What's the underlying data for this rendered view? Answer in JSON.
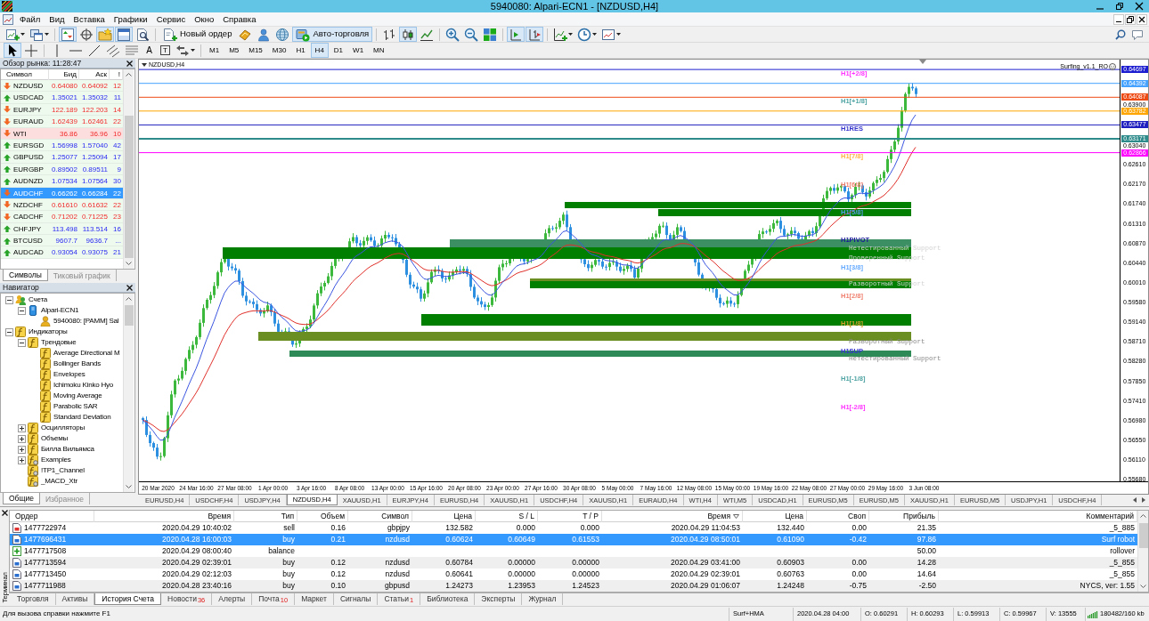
{
  "window": {
    "title": "5940080: Alpari-ECN1 - [NZDUSD,H4]"
  },
  "menu": [
    "Файл",
    "Вид",
    "Вставка",
    "Графики",
    "Сервис",
    "Окно",
    "Справка"
  ],
  "toolbar_1": [
    {
      "kind": "new-chart",
      "dropdown": true,
      "pressed": false
    },
    {
      "kind": "profiles",
      "dropdown": true,
      "pressed": false
    },
    {
      "kind": "separator"
    },
    {
      "kind": "market-watch",
      "pressed": true
    },
    {
      "kind": "data-window",
      "pressed": false
    },
    {
      "kind": "navigator",
      "pressed": true
    },
    {
      "kind": "terminal",
      "pressed": true
    },
    {
      "kind": "tester",
      "pressed": false
    },
    {
      "kind": "separator"
    },
    {
      "kind": "new-order",
      "label": "Новый ордер",
      "pressed": false
    },
    {
      "kind": "metaeditor",
      "pressed": false
    },
    {
      "kind": "account",
      "pressed": false
    },
    {
      "kind": "signals",
      "pressed": false
    },
    {
      "kind": "auto-trading",
      "label": "Авто-торговля",
      "pressed": true
    },
    {
      "kind": "separator"
    },
    {
      "kind": "bar-chart",
      "pressed": false
    },
    {
      "kind": "candles",
      "pressed": true
    },
    {
      "kind": "line-chart",
      "pressed": false
    },
    {
      "kind": "separator"
    },
    {
      "kind": "zoom-in",
      "pressed": false
    },
    {
      "kind": "zoom-out",
      "pressed": false
    },
    {
      "kind": "tile",
      "pressed": false
    },
    {
      "kind": "separator"
    },
    {
      "kind": "autoscroll",
      "pressed": true
    },
    {
      "kind": "shift",
      "pressed": true
    },
    {
      "kind": "separator"
    },
    {
      "kind": "indicators",
      "dropdown": true,
      "pressed": false
    },
    {
      "kind": "periods",
      "dropdown": true,
      "pressed": false
    },
    {
      "kind": "templates",
      "dropdown": true,
      "pressed": false
    }
  ],
  "toolbar_2": [
    {
      "kind": "cursor",
      "pressed": true
    },
    {
      "kind": "crosshair",
      "pressed": false
    },
    {
      "kind": "separator"
    },
    {
      "kind": "vertical-line",
      "pressed": false
    },
    {
      "kind": "horizontal-line",
      "pressed": false
    },
    {
      "kind": "trend-line",
      "pressed": false
    },
    {
      "kind": "channel",
      "pressed": false
    },
    {
      "kind": "fibonacci",
      "pressed": false
    },
    {
      "kind": "text",
      "glyph": "A",
      "pressed": false
    },
    {
      "kind": "label",
      "glyph": "T",
      "pressed": false
    },
    {
      "kind": "arrows",
      "dropdown": true,
      "pressed": false
    },
    {
      "kind": "separator"
    }
  ],
  "timeframes": [
    {
      "label": "M1",
      "selected": false
    },
    {
      "label": "M5",
      "selected": false
    },
    {
      "label": "M15",
      "selected": false
    },
    {
      "label": "M30",
      "selected": false
    },
    {
      "label": "H1",
      "selected": false
    },
    {
      "label": "H4",
      "selected": true
    },
    {
      "label": "D1",
      "selected": false
    },
    {
      "label": "W1",
      "selected": false
    },
    {
      "label": "MN",
      "selected": false
    }
  ],
  "market_watch": {
    "title": "Обзор рынка: 11:28:47",
    "columns": [
      "Символ",
      "Бид",
      "Аск",
      "!"
    ],
    "rows": [
      {
        "symbol": "NZDUSD",
        "bid": "0.64080",
        "ask": "0.64092",
        "spread": "12",
        "up": false,
        "highlighted": false,
        "selected": false
      },
      {
        "symbol": "USDCAD",
        "bid": "1.35021",
        "ask": "1.35032",
        "spread": "11",
        "up": true,
        "highlighted": false,
        "selected": false
      },
      {
        "symbol": "EURJPY",
        "bid": "122.189",
        "ask": "122.203",
        "spread": "14",
        "up": false,
        "highlighted": false,
        "selected": false
      },
      {
        "symbol": "EURAUD",
        "bid": "1.62439",
        "ask": "1.62461",
        "spread": "22",
        "up": false,
        "highlighted": false,
        "selected": false
      },
      {
        "symbol": "WTI",
        "bid": "36.86",
        "ask": "36.96",
        "spread": "10",
        "up": false,
        "highlighted": true,
        "selected": false
      },
      {
        "symbol": "EURSGD",
        "bid": "1.56998",
        "ask": "1.57040",
        "spread": "42",
        "up": true,
        "highlighted": false,
        "selected": false
      },
      {
        "symbol": "GBPUSD",
        "bid": "1.25077",
        "ask": "1.25094",
        "spread": "17",
        "up": true,
        "highlighted": false,
        "selected": false
      },
      {
        "symbol": "EURGBP",
        "bid": "0.89502",
        "ask": "0.89511",
        "spread": "9",
        "up": true,
        "highlighted": false,
        "selected": false
      },
      {
        "symbol": "AUDNZD",
        "bid": "1.07534",
        "ask": "1.07564",
        "spread": "30",
        "up": true,
        "highlighted": false,
        "selected": false
      },
      {
        "symbol": "AUDCHF",
        "bid": "0.66262",
        "ask": "0.66284",
        "spread": "22",
        "up": false,
        "highlighted": false,
        "selected": true
      },
      {
        "symbol": "NZDCHF",
        "bid": "0.61610",
        "ask": "0.61632",
        "spread": "22",
        "up": false,
        "highlighted": false,
        "selected": false
      },
      {
        "symbol": "CADCHF",
        "bid": "0.71202",
        "ask": "0.71225",
        "spread": "23",
        "up": false,
        "highlighted": false,
        "selected": false
      },
      {
        "symbol": "CHFJPY",
        "bid": "113.498",
        "ask": "113.514",
        "spread": "16",
        "up": true,
        "highlighted": false,
        "selected": false
      },
      {
        "symbol": "BTCUSD",
        "bid": "9607.7",
        "ask": "9636.7",
        "spread": "...",
        "up": true,
        "highlighted": false,
        "selected": false
      },
      {
        "symbol": "AUDCAD",
        "bid": "0.93054",
        "ask": "0.93075",
        "spread": "21",
        "up": true,
        "highlighted": false,
        "selected": false
      }
    ],
    "tabs": [
      {
        "label": "Символы",
        "selected": true
      },
      {
        "label": "Тиковый график",
        "selected": false
      }
    ]
  },
  "navigator": {
    "title": "Навигатор",
    "tree": [
      {
        "label": "Счета",
        "kind": "accounts",
        "expanded": true,
        "children": [
          {
            "label": "Alpari-ECN1",
            "kind": "server",
            "expanded": true,
            "children": [
              {
                "label": "5940080: [PAMM] Sal",
                "kind": "account"
              }
            ]
          }
        ]
      },
      {
        "label": "Индикаторы",
        "kind": "indicator",
        "expanded": true,
        "children": [
          {
            "label": "Трендовые",
            "kind": "indicator",
            "expanded": true,
            "children": [
              {
                "label": "Average Directional M",
                "kind": "indicator"
              },
              {
                "label": "Bollinger Bands",
                "kind": "indicator"
              },
              {
                "label": "Envelopes",
                "kind": "indicator"
              },
              {
                "label": "Ichimoku Kinko Hyo",
                "kind": "indicator"
              },
              {
                "label": "Moving Average",
                "kind": "indicator"
              },
              {
                "label": "Parabolic SAR",
                "kind": "indicator"
              },
              {
                "label": "Standard Deviation",
                "kind": "indicator"
              }
            ]
          },
          {
            "label": "Осцилляторы",
            "kind": "indicator",
            "expanded": false
          },
          {
            "label": "Объемы",
            "kind": "indicator",
            "expanded": false
          },
          {
            "label": "Билла Вильямса",
            "kind": "indicator",
            "expanded": false
          },
          {
            "label": "Examples",
            "kind": "custom",
            "expanded": false
          },
          {
            "label": "!TP1_Channel",
            "kind": "custom"
          },
          {
            "label": "_MACD_Xtr",
            "kind": "custom"
          }
        ]
      }
    ],
    "tabs": [
      {
        "label": "Общие",
        "selected": true
      },
      {
        "label": "Избранное",
        "selected": false
      }
    ]
  },
  "chart": {
    "title": "NZDUSD,H4",
    "indicator": "Surfing_v1.1_RO",
    "price_levels": [
      {
        "label": "0.64697",
        "color": "#1c1cd0"
      },
      {
        "label": "0.64392",
        "color": "#45a2ff"
      },
      {
        "label": "0.64087",
        "color": "#ee4a14"
      },
      {
        "label": "0.63782",
        "color": "#ffa500"
      },
      {
        "label": "0.63477",
        "color": "#2020c0"
      },
      {
        "label": "0.63171",
        "color": "#2e8b8b"
      },
      {
        "label": "0.62866",
        "color": "#ff00ff"
      }
    ],
    "price_ticks": [
      "0.63900",
      "0.63040",
      "0.62610",
      "0.62170",
      "0.61740",
      "0.61310",
      "0.60870",
      "0.60440",
      "0.60010",
      "0.59580",
      "0.59140",
      "0.58710",
      "0.58280",
      "0.57850",
      "0.57410",
      "0.56980",
      "0.56550",
      "0.56110",
      "0.55680"
    ],
    "time_ticks": [
      "20 Mar 2020",
      "24 Mar 16:00",
      "27 Mar 08:00",
      "1 Apr 00:00",
      "3 Apr 16:00",
      "8 Apr 08:00",
      "13 Apr 00:00",
      "15 Apr 16:00",
      "20 Apr 08:00",
      "23 Apr 00:00",
      "27 Apr 16:00",
      "30 Apr 08:00",
      "5 May 00:00",
      "7 May 16:00",
      "12 May 08:00",
      "15 May 00:00",
      "19 May 16:00",
      "22 May 08:00",
      "27 May 00:00",
      "29 May 16:00",
      "3 Jun 08:00"
    ],
    "level_labels": [
      {
        "text": "H1[+2/8]",
        "color": "#ff33ff"
      },
      {
        "text": "H1[+1/8]",
        "color": "#4fa3a3"
      },
      {
        "text": "H1RES",
        "color": "#3333cc"
      },
      {
        "text": "H1[7/8]",
        "color": "#ffb347"
      },
      {
        "text": "H1[6/8]",
        "color": "#f07f6e"
      },
      {
        "text": "H1[5/8]",
        "color": "#5a9ae8"
      },
      {
        "text": "H1PIVOT",
        "color": "#1a1a99"
      },
      {
        "text": "H1[3/8]",
        "color": "#66aaff"
      },
      {
        "text": "H1[2/8]",
        "color": "#f07f6e"
      },
      {
        "text": "H1[1/8]",
        "color": "#d9a030"
      },
      {
        "text": "H1SUP",
        "color": "#3333cc"
      },
      {
        "text": "H1[-1/8]",
        "color": "#4fa3a3"
      },
      {
        "text": "H1[-2/8]",
        "color": "#ff33ff"
      }
    ],
    "zones": [
      {
        "color": "#007f00"
      },
      {
        "color": "#007f00"
      },
      {
        "color": "#3b8f63"
      },
      {
        "color": "#007f00"
      },
      {
        "color": "#6b8e23"
      },
      {
        "color": "#007f00"
      },
      {
        "color": "#007f00"
      },
      {
        "color": "#6b8e23"
      },
      {
        "color": "#2e8b57"
      }
    ],
    "zone_labels": [
      "Нетестированный Support",
      "Проверенный Support",
      "Разворотный Support",
      "Разворотный Support",
      "Нетестированный Support"
    ]
  },
  "chart_tabs": [
    {
      "label": "EURUSD,H4",
      "selected": false
    },
    {
      "label": "USDCHF,H4",
      "selected": false
    },
    {
      "label": "USDJPY,H4",
      "selected": false
    },
    {
      "label": "NZDUSD,H4",
      "selected": true
    },
    {
      "label": "XAUUSD,H1",
      "selected": false
    },
    {
      "label": "EURJPY,H4",
      "selected": false
    },
    {
      "label": "EURUSD,H4",
      "selected": false
    },
    {
      "label": "XAUUSD,H1",
      "selected": false
    },
    {
      "label": "USDCHF,H4",
      "selected": false
    },
    {
      "label": "XAUUSD,H1",
      "selected": false
    },
    {
      "label": "EURAUD,H4",
      "selected": false
    },
    {
      "label": "WTI,H4",
      "selected": false
    },
    {
      "label": "WTI,M5",
      "selected": false
    },
    {
      "label": "USDCAD,H1",
      "selected": false
    },
    {
      "label": "EURUSD,M5",
      "selected": false
    },
    {
      "label": "EURUSD,M5",
      "selected": false
    },
    {
      "label": "XAUUSD,H1",
      "selected": false
    },
    {
      "label": "EURUSD,M5",
      "selected": false
    },
    {
      "label": "USDJPY,H1",
      "selected": false
    },
    {
      "label": "USDCHF,H4",
      "selected": false
    }
  ],
  "terminal": {
    "title": "Терминал",
    "columns": [
      {
        "label": "Ордер",
        "sorted": false
      },
      {
        "label": "Время",
        "sorted": false
      },
      {
        "label": "Тип",
        "sorted": false
      },
      {
        "label": "Объем",
        "sorted": false
      },
      {
        "label": "Символ",
        "sorted": false
      },
      {
        "label": "Цена",
        "sorted": false
      },
      {
        "label": "S / L",
        "sorted": false
      },
      {
        "label": "T / P",
        "sorted": false
      },
      {
        "label": "Время",
        "sorted": true
      },
      {
        "label": "Цена",
        "sorted": false
      },
      {
        "label": "Своп",
        "sorted": false
      },
      {
        "label": "Прибыль",
        "sorted": false
      },
      {
        "label": "Комментарий",
        "sorted": false
      }
    ],
    "rows": [
      {
        "kind": "sell",
        "selected": false,
        "cells": [
          "1477722974",
          "2020.04.29 10:40:02",
          "sell",
          "0.16",
          "gbpjpy",
          "132.582",
          "0.000",
          "0.000",
          "2020.04.29 11:04:53",
          "132.440",
          "0.00",
          "21.35",
          "_5_885"
        ]
      },
      {
        "kind": "buy",
        "selected": true,
        "cells": [
          "1477696431",
          "2020.04.28 16:00:03",
          "buy",
          "0.21",
          "nzdusd",
          "0.60624",
          "0.60649",
          "0.61553",
          "2020.04.29 08:50:01",
          "0.61090",
          "-0.42",
          "97.86",
          "Surf robot"
        ]
      },
      {
        "kind": "balance",
        "selected": false,
        "cells": [
          "1477717508",
          "2020.04.29 08:00:40",
          "balance",
          null,
          null,
          null,
          null,
          null,
          null,
          null,
          null,
          "50.00",
          "rollover"
        ]
      },
      {
        "kind": "buy",
        "selected": false,
        "cells": [
          "1477713594",
          "2020.04.29 02:39:01",
          "buy",
          "0.12",
          "nzdusd",
          "0.60784",
          "0.00000",
          "0.00000",
          "2020.04.29 03:41:00",
          "0.60903",
          "0.00",
          "14.28",
          "_5_855"
        ]
      },
      {
        "kind": "buy",
        "selected": false,
        "cells": [
          "1477713450",
          "2020.04.29 02:12:03",
          "buy",
          "0.12",
          "nzdusd",
          "0.60641",
          "0.00000",
          "0.00000",
          "2020.04.29 02:39:01",
          "0.60763",
          "0.00",
          "14.64",
          "_5_855"
        ]
      },
      {
        "kind": "buy",
        "selected": false,
        "cells": [
          "1477711988",
          "2020.04.28 23:40:16",
          "buy",
          "0.10",
          "gbpusd",
          "1.24273",
          "1.23953",
          "1.24523",
          "2020.04.29 01:06:07",
          "1.24248",
          "-0.75",
          "-2.50",
          "NYCS, ver: 1.55"
        ]
      }
    ],
    "tabs": [
      {
        "label": "Торговля",
        "selected": false
      },
      {
        "label": "Активы",
        "selected": false
      },
      {
        "label": "История Счета",
        "selected": true
      },
      {
        "label": "Новости",
        "badge": "36",
        "selected": false
      },
      {
        "label": "Алерты",
        "selected": false
      },
      {
        "label": "Почта",
        "badge": "10",
        "selected": false
      },
      {
        "label": "Маркет",
        "selected": false
      },
      {
        "label": "Сигналы",
        "selected": false
      },
      {
        "label": "Статьи",
        "badge": "1",
        "selected": false
      },
      {
        "label": "Библиотека",
        "selected": false
      },
      {
        "label": "Эксперты",
        "selected": false
      },
      {
        "label": "Журнал",
        "selected": false
      }
    ]
  },
  "status_bar": {
    "help": "Для вызова справки нажмите F1",
    "profile": "Surf+HMA",
    "time": "2020.04.28 04:00",
    "open": "O: 0.60291",
    "high": "H: 0.60293",
    "low": "L: 0.59913",
    "close": "C: 0.59967",
    "volume": "V: 13555",
    "traffic": "180482/160 kb"
  }
}
